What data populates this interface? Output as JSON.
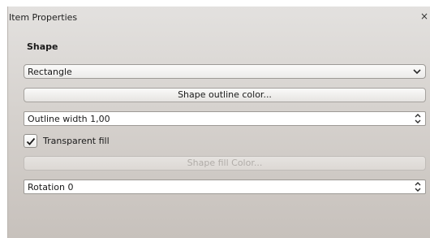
{
  "panel": {
    "title": "Item Properties",
    "close_glyph": "×"
  },
  "shape_section": {
    "label": "Shape",
    "shape_select": {
      "value": "Rectangle"
    },
    "outline_color_button": {
      "label": "Shape outline color..."
    },
    "outline_width": {
      "value": "Outline width 1,00"
    },
    "transparent_fill": {
      "label": "Transparent fill",
      "checked": true
    },
    "fill_color_button": {
      "label": "Shape fill Color...",
      "enabled": false
    },
    "rotation": {
      "value": "Rotation 0"
    }
  },
  "icons": {
    "close": "close-icon",
    "dropdown": "chevron-down-icon",
    "spinner": "spin-arrows-icon",
    "check": "checkmark-icon"
  },
  "colors": {
    "panel_top": "#e3e1df",
    "panel_bottom": "#c7c1bc",
    "disabled_text": "#b0aca8"
  }
}
